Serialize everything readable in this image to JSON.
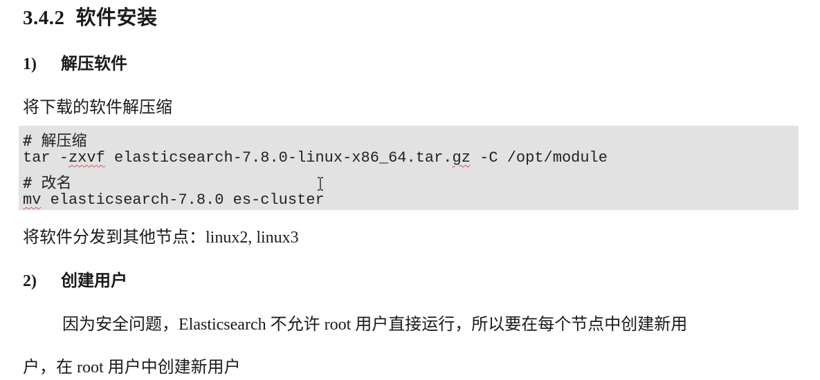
{
  "section": {
    "number": "3.4.2",
    "title": "软件安装"
  },
  "step1": {
    "number": "1)",
    "title": "解压软件"
  },
  "intro_text": "将下载的软件解压缩",
  "code": {
    "comment1": "# 解压缩",
    "cmd1": {
      "prefix": "tar -",
      "flags": "zxvf",
      "mid": " elasticsearch-7.8.0-linux-x86_64.tar.",
      "ext": "gz",
      "suffix": " -C /opt/module"
    },
    "comment2": "# 改名",
    "cmd2": {
      "prefix": "mv",
      "rest": " elasticsearch-7.8.0 es-cluster"
    }
  },
  "distribute_text": "将软件分发到其他节点：linux2, linux3",
  "step2": {
    "number": "2)",
    "title": "创建用户"
  },
  "user_para_line1": "因为安全问题，Elasticsearch 不允许 root 用户直接运行，所以要在每个节点中创建新用",
  "user_para_line2": "户，在 root 用户中创建新用户",
  "icons": {
    "cursor": "text-cursor-icon"
  }
}
